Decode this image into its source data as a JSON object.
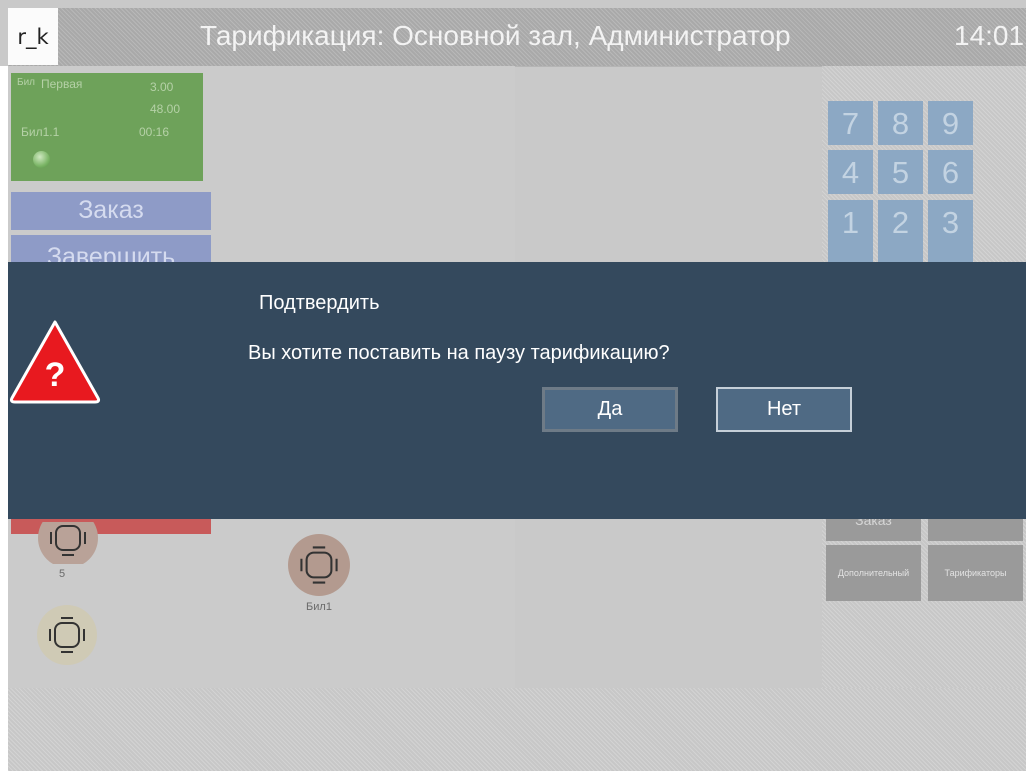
{
  "app": {
    "logo": "r_k",
    "title": "Тарификация: Основной зал, Администратор",
    "clock": "14:01"
  },
  "ticket": {
    "name": "Бил",
    "tariff": "Первая",
    "rate": "3.00",
    "amount": "48.00",
    "table": "Бил1.1",
    "time": "00:16"
  },
  "menu": {
    "order_label": "Заказ",
    "finish_label": "Завершить"
  },
  "numpad": {
    "keys": [
      "7",
      "8",
      "9",
      "4",
      "5",
      "6",
      "1",
      "2",
      "3"
    ]
  },
  "right_panel": {
    "hidden_label": "Заказ",
    "extra_label": "Дополнительный",
    "tariffs_label": "Тарификаторы"
  },
  "tables": [
    {
      "label": "5"
    },
    {
      "label": "Бил1"
    },
    {
      "label": ""
    }
  ],
  "dialog": {
    "title": "Подтвердить",
    "message": "Вы хотите поставить на паузу тарификацию?",
    "icon": "warning-question-icon",
    "yes_label": "Да",
    "no_label": "Нет"
  },
  "colors": {
    "overlay": "#34495d",
    "ticket_green": "#6ea25a",
    "menu_blue": "#8e9bc7",
    "numpad_blue": "#8ca8c4",
    "warning_red": "#e8191f"
  }
}
